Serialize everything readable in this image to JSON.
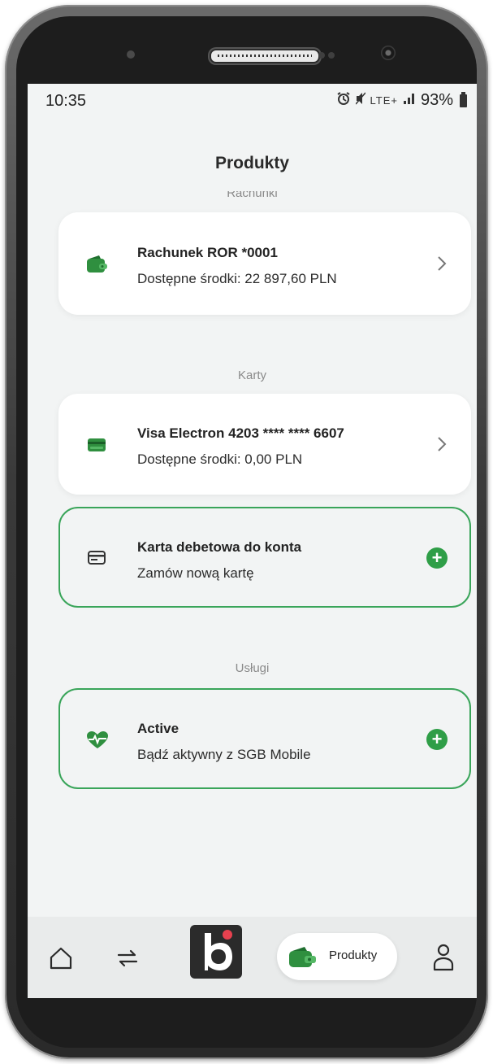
{
  "status_bar": {
    "time": "10:35",
    "signal_icons": "LTE+",
    "battery": "93%"
  },
  "page": {
    "title": "Produkty"
  },
  "sections": {
    "accounts": {
      "header": "Rachunki",
      "items": [
        {
          "name": "Rachunek ROR *0001",
          "detail": "Dostępne środki: 22 897,60 PLN",
          "icon": "wallet-icon"
        }
      ]
    },
    "cards": {
      "header": "Karty",
      "items": [
        {
          "name": "Visa Electron 4203 **** **** 6607",
          "detail": "Dostępne środki: 0,00 PLN",
          "icon": "card-icon"
        },
        {
          "name": "Karta debetowa do konta",
          "detail": "Zamów nową kartę",
          "icon": "card-outline-icon",
          "action": "add"
        }
      ]
    },
    "services": {
      "header": "Usługi",
      "items": [
        {
          "name": "Active",
          "detail": "Bądź aktywny z SGB Mobile",
          "icon": "heart-pulse-icon",
          "action": "add"
        }
      ]
    }
  },
  "bottom_nav": {
    "items": [
      {
        "icon": "home-icon"
      },
      {
        "icon": "transfer-icon"
      },
      {
        "icon": "bank-logo-icon"
      },
      {
        "icon": "wallet-icon",
        "label": "Produkty",
        "active": true
      },
      {
        "icon": "profile-icon"
      }
    ]
  },
  "colors": {
    "accent": "#3aa55a",
    "plus_button": "#2f9e47",
    "wallet_green": "#2f8f3f",
    "background": "#f2f4f4",
    "logo_dot": "#e8414f"
  }
}
